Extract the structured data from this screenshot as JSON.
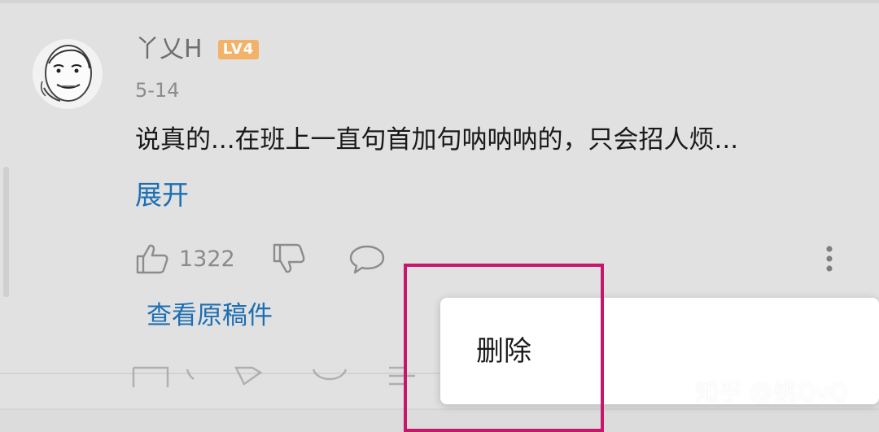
{
  "comment": {
    "username": "丫乂H",
    "level_badge": "LV4",
    "date": "5-14",
    "text": "说真的...在班上一直句首加句呐呐呐的，只会招人烦...",
    "expand_label": "展开",
    "like_count": "1322",
    "view_original_label": "查看原稿件"
  },
  "icons": {
    "like": "thumbs-up-icon",
    "dislike": "thumbs-down-icon",
    "reply": "comment-bubble-icon",
    "more": "more-vertical-icon"
  },
  "popup_menu": {
    "items": [
      {
        "label": "删除"
      }
    ]
  },
  "watermark": "知乎 @姚QvQ",
  "colors": {
    "link": "#1d6fb3",
    "badge": "#f3b26a",
    "highlight": "#c8176b",
    "background": "#e1e1e1"
  }
}
